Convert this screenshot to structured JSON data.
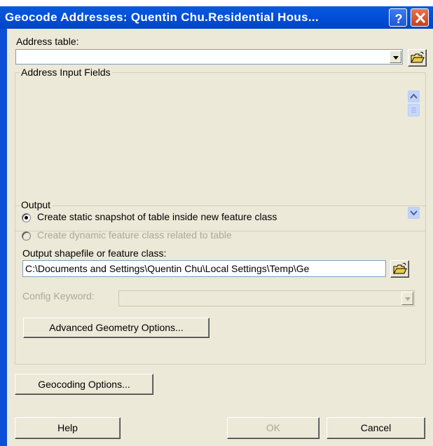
{
  "window": {
    "title": "Geocode Addresses:  Quentin Chu.Residential Hous...",
    "help_button": "?",
    "close_button": "X"
  },
  "address_table": {
    "label": "Address table:",
    "value": ""
  },
  "address_input_fields": {
    "group_label": "Address Input Fields"
  },
  "output": {
    "group_label": "Output",
    "option_static": "Create static snapshot of table inside new feature class",
    "option_dynamic": "Create dynamic feature class related to table",
    "selected_option": "static",
    "shapefile_label": "Output shapefile or feature class:",
    "shapefile_value": "C:\\Documents and Settings\\Quentin Chu\\Local Settings\\Temp\\Ge",
    "config_label": "Config Keyword:",
    "config_value": "",
    "advanced_button": "Advanced Geometry Options..."
  },
  "geocoding_options_button": "Geocoding Options...",
  "footer": {
    "help_button": "Help",
    "ok_button": "OK",
    "cancel_button": "Cancel"
  },
  "colors": {
    "title_bar": "#0250dc",
    "dialog_face": "#ece9d8",
    "close_button": "#c63f1f"
  }
}
